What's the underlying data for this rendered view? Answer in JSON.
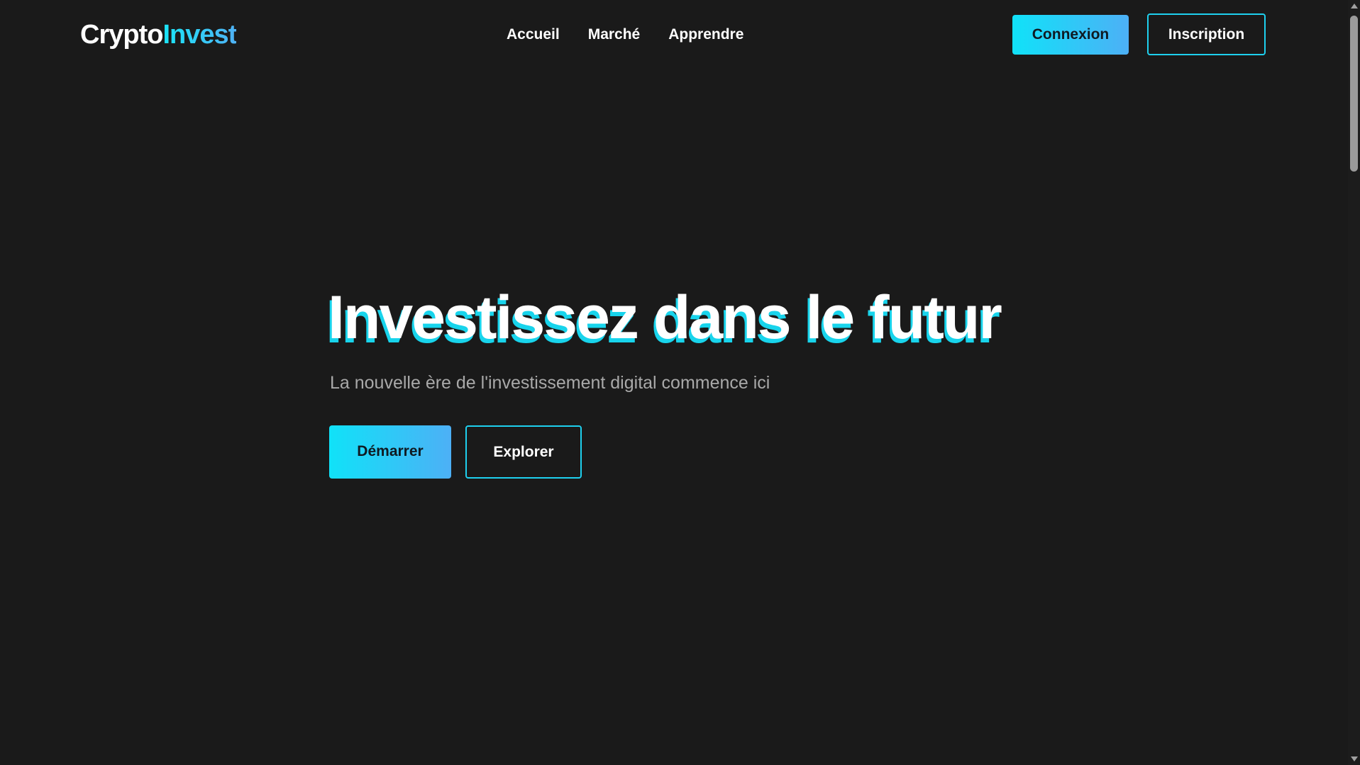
{
  "header": {
    "logo": {
      "part1": "Crypto",
      "part2": "Invest"
    },
    "nav": {
      "items": [
        "Accueil",
        "Marché",
        "Apprendre"
      ]
    },
    "buttons": {
      "login": "Connexion",
      "signup": "Inscription"
    }
  },
  "hero": {
    "title": "Investissez dans le futur",
    "subtitle": "La nouvelle ère de l'investissement digital commence ici",
    "primary_button": "Démarrer",
    "secondary_button": "Explorer"
  },
  "colors": {
    "background": "#1a1a1a",
    "accent_start": "#10e2f8",
    "accent_end": "#4db0f6",
    "outline": "#1ed0ef",
    "subtitle_text": "#a9a9a9"
  }
}
